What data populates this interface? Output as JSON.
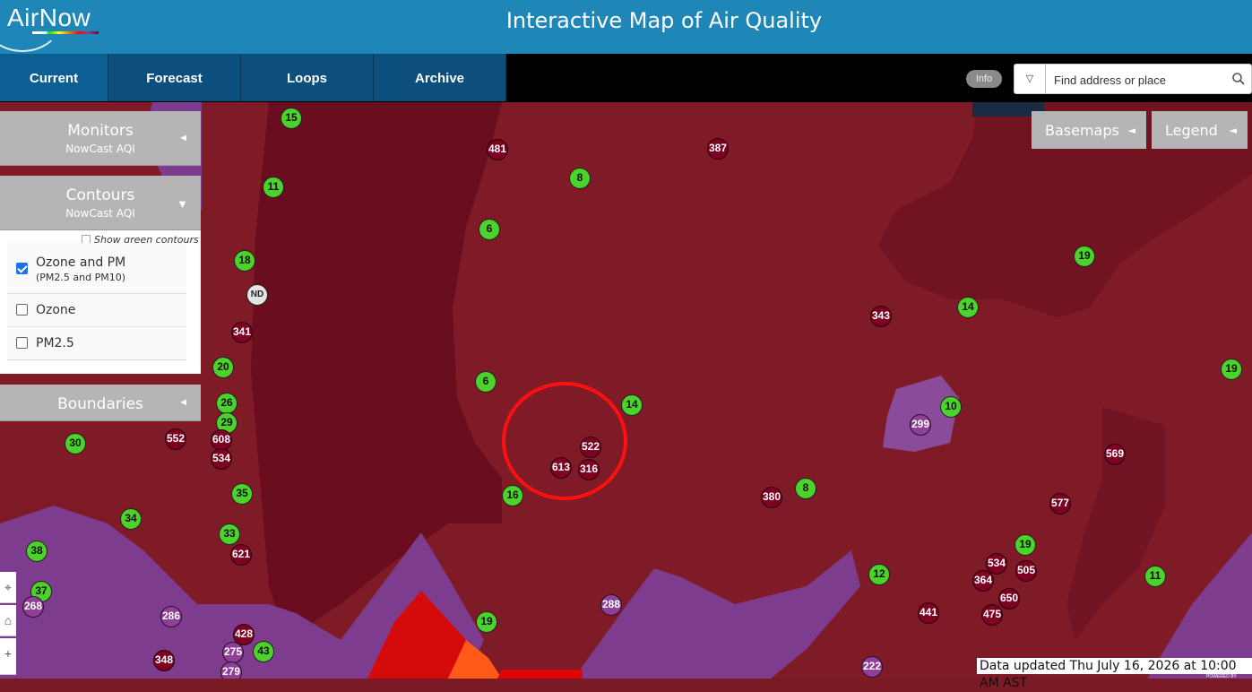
{
  "header": {
    "logo_text": "AirNow",
    "title": "Interactive Map of Air Quality"
  },
  "nav": {
    "tabs": [
      {
        "label": "Current",
        "active": true
      },
      {
        "label": "Forecast",
        "active": false
      },
      {
        "label": "Loops",
        "active": false
      },
      {
        "label": "Archive",
        "active": false
      }
    ],
    "info_toggle": "Info",
    "search_placeholder": "Find address or place"
  },
  "panels": {
    "monitors": {
      "title": "Monitors",
      "subtitle": "NowCast AQI",
      "arrow": "◄"
    },
    "contours": {
      "title": "Contours",
      "subtitle": "NowCast AQI",
      "arrow": "▼",
      "show_green": "Show green contours",
      "layers": [
        {
          "label": "Ozone and PM",
          "sub": "(PM2.5 and PM10)",
          "checked": true
        },
        {
          "label": "Ozone",
          "checked": false
        },
        {
          "label": "PM2.5",
          "checked": false
        }
      ]
    },
    "boundaries": {
      "title": "Boundaries",
      "arrow": "◄"
    }
  },
  "buttons": {
    "basemaps": "Basemaps",
    "legend": "Legend",
    "arrow": "◄"
  },
  "colors": {
    "good": "#4bd32b",
    "very_unhealthy": "#8f3f97",
    "hazardous": "#7e0023",
    "unhealthy": "#ff0000",
    "highlight": "#ff1010"
  },
  "footer": {
    "data_updated": "Data updated Thu July 16, 2026 at 10:00 AM AST",
    "powered_by": "POWERED BY"
  },
  "monitors": [
    {
      "label": "15",
      "level": "green"
    },
    {
      "label": "481",
      "level": "maroon"
    },
    {
      "label": "387",
      "level": "maroon"
    },
    {
      "label": "8",
      "level": "green"
    },
    {
      "label": "11",
      "level": "green"
    },
    {
      "label": "6",
      "level": "green"
    },
    {
      "label": "18",
      "level": "green"
    },
    {
      "label": "ND",
      "level": "gray"
    },
    {
      "label": "341",
      "level": "maroon"
    },
    {
      "label": "343",
      "level": "maroon"
    },
    {
      "label": "14",
      "level": "green"
    },
    {
      "label": "19",
      "level": "green"
    },
    {
      "label": "19",
      "level": "green"
    },
    {
      "label": "20",
      "level": "green"
    },
    {
      "label": "6",
      "level": "green"
    },
    {
      "label": "14",
      "level": "green"
    },
    {
      "label": "26",
      "level": "green"
    },
    {
      "label": "29",
      "level": "green"
    },
    {
      "label": "10",
      "level": "green"
    },
    {
      "label": "299",
      "level": "purple"
    },
    {
      "label": "30",
      "level": "green"
    },
    {
      "label": "552",
      "level": "maroon"
    },
    {
      "label": "608",
      "level": "maroon"
    },
    {
      "label": "534",
      "level": "maroon"
    },
    {
      "label": "522",
      "level": "maroon"
    },
    {
      "label": "613",
      "level": "maroon"
    },
    {
      "label": "316",
      "level": "maroon"
    },
    {
      "label": "569",
      "level": "maroon"
    },
    {
      "label": "35",
      "level": "green"
    },
    {
      "label": "16",
      "level": "green"
    },
    {
      "label": "380",
      "level": "maroon"
    },
    {
      "label": "8",
      "level": "green"
    },
    {
      "label": "577",
      "level": "maroon"
    },
    {
      "label": "34",
      "level": "green"
    },
    {
      "label": "33",
      "level": "green"
    },
    {
      "label": "38",
      "level": "green"
    },
    {
      "label": "621",
      "level": "maroon"
    },
    {
      "label": "19",
      "level": "green"
    },
    {
      "label": "534",
      "level": "maroon"
    },
    {
      "label": "505",
      "level": "maroon"
    },
    {
      "label": "12",
      "level": "green"
    },
    {
      "label": "364",
      "level": "maroon"
    },
    {
      "label": "11",
      "level": "green"
    },
    {
      "label": "37",
      "level": "green"
    },
    {
      "label": "268",
      "level": "purple"
    },
    {
      "label": "650",
      "level": "maroon"
    },
    {
      "label": "288",
      "level": "purple"
    },
    {
      "label": "286",
      "level": "purple"
    },
    {
      "label": "441",
      "level": "maroon"
    },
    {
      "label": "475",
      "level": "maroon"
    },
    {
      "label": "19",
      "level": "green"
    },
    {
      "label": "428",
      "level": "maroon"
    },
    {
      "label": "43",
      "level": "green"
    },
    {
      "label": "275",
      "level": "purple"
    },
    {
      "label": "348",
      "level": "maroon"
    },
    {
      "label": "279",
      "level": "purple"
    },
    {
      "label": "222",
      "level": "purple"
    }
  ]
}
